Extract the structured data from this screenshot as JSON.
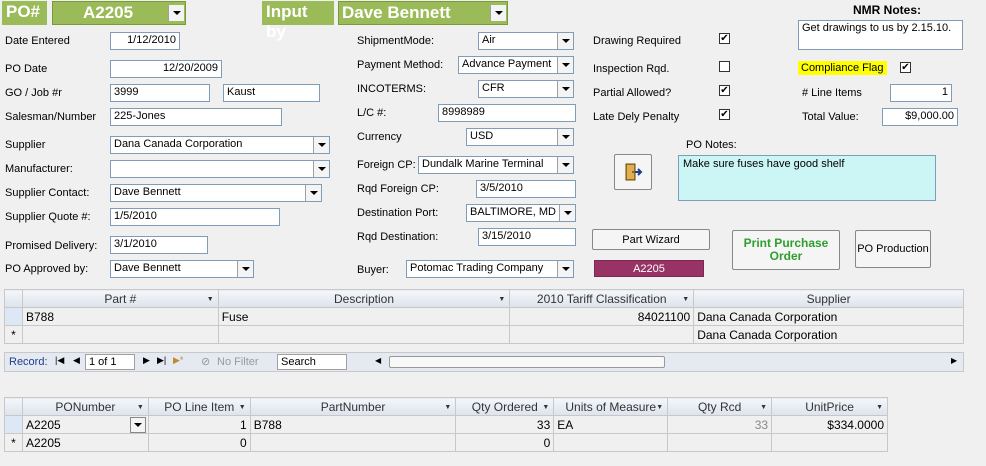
{
  "header": {
    "po_label": "PO#",
    "po_value": "A2205",
    "input_by_label": "Input by",
    "input_by_value": "Dave Bennett"
  },
  "left": {
    "date_entered_label": "Date Entered",
    "date_entered": "1/12/2010",
    "po_date_label": "PO Date",
    "po_date": "12/20/2009",
    "go_job_label": "GO / Job #r",
    "go_job": "3999",
    "go_job_name": "Kaust",
    "salesman_label": "Salesman/Number",
    "salesman": "225-Jones",
    "supplier_label": "Supplier",
    "supplier": "Dana Canada Corporation",
    "manufacturer_label": "Manufacturer:",
    "manufacturer": "",
    "supplier_contact_label": "Supplier Contact:",
    "supplier_contact": "Dave Bennett",
    "supplier_quote_label": "Supplier Quote #:",
    "supplier_quote": "1/5/2010",
    "promised_delivery_label": "Promised Delivery:",
    "promised_delivery": "3/1/2010",
    "po_approved_label": "PO Approved by:",
    "po_approved": "Dave Bennett"
  },
  "middle": {
    "shipment_mode_label": "ShipmentMode:",
    "shipment_mode": "Air",
    "payment_method_label": "Payment Method:",
    "payment_method": "Advance Payment",
    "incoterms_label": "INCOTERMS:",
    "incoterms": "CFR",
    "lc_label": "L/C #:",
    "lc": "8998989",
    "currency_label": "Currency",
    "currency": "USD",
    "foreign_cp_label": "Foreign CP:",
    "foreign_cp": "Dundalk Marine Terminal",
    "rqd_foreign_cp_label": "Rqd Foreign CP:",
    "rqd_foreign_cp": "3/5/2010",
    "destination_port_label": "Destination Port:",
    "destination_port": "BALTIMORE, MD",
    "rqd_destination_label": "Rqd Destination:",
    "rqd_destination": "3/15/2010",
    "buyer_label": "Buyer:",
    "buyer": "Potomac Trading Company"
  },
  "flags": {
    "drawing_required_label": "Drawing Required",
    "inspection_label": "Inspection Rqd.",
    "partial_label": "Partial Allowed?",
    "late_label": "Late Dely Penalty",
    "check_mark": "✔"
  },
  "right": {
    "nmr_label": "NMR Notes:",
    "nmr_notes": "Get drawings to us by 2.15.10.",
    "compliance_label": "Compliance Flag",
    "line_items_label": "# Line Items",
    "line_items": "1",
    "total_value_label": "Total Value:",
    "total_value": "$9,000.00",
    "po_notes_label": "PO Notes:",
    "po_notes": "Make sure fuses have good shelf",
    "part_wizard": "Part Wizard",
    "po_badge": "A2205",
    "print_po": "Print Purchase Order",
    "po_production": "PO Production"
  },
  "parts_grid": {
    "columns": [
      "Part #",
      "Description",
      "2010 Tariff Classification",
      "Supplier"
    ],
    "rows": [
      [
        "B788",
        "Fuse",
        "84021100",
        "Dana Canada Corporation"
      ],
      [
        "",
        "",
        "",
        "Dana Canada Corporation"
      ]
    ],
    "new_marker": "*"
  },
  "navbar": {
    "record_label": "Record:",
    "record_value": "1 of 1",
    "no_filter": "No Filter",
    "search": "Search"
  },
  "lines_grid": {
    "columns": [
      "PONumber",
      "PO Line Item",
      "PartNumber",
      "Qty Ordered",
      "Units of Measure",
      "Qty Rcd",
      "UnitPrice"
    ],
    "rows": [
      [
        "A2205",
        "1",
        "B788",
        "33",
        "EA",
        "33",
        "$334.0000"
      ],
      [
        "A2205",
        "0",
        "",
        "0",
        "",
        "",
        ""
      ]
    ],
    "new_marker": "*"
  },
  "colors": {
    "header_green": "#9bbb59",
    "notes_cyan": "#ccf5f5",
    "compliance_yellow": "#ffff00",
    "badge_maroon": "#993366",
    "print_green": "#2e9e2e"
  }
}
